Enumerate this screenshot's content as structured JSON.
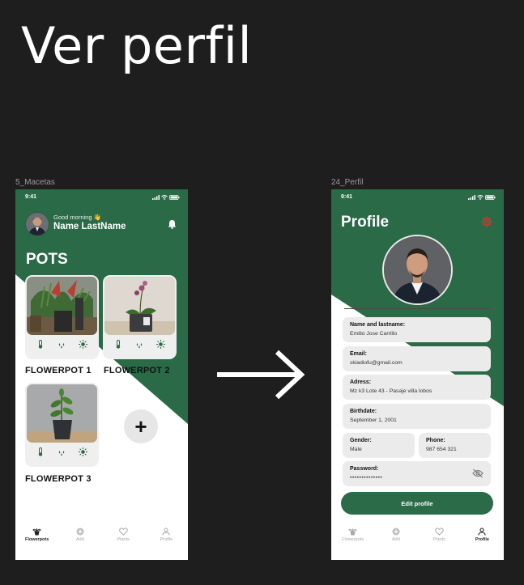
{
  "heading": "Ver perfil",
  "colors": {
    "background": "#1e1e1e",
    "brand_green": "#2a6a47",
    "button_green": "#2c6b48",
    "card_gray": "#efefef",
    "field_gray": "#ebebeb",
    "gear_red": "#c83b2c"
  },
  "frame_left": {
    "label": "5_Macetas",
    "status_time": "9:41",
    "greeting": "Good morning 👋",
    "user_name": "Name LastName",
    "section_title": "POTS",
    "pots": [
      {
        "label": "FLOWERPOT 1",
        "icons": [
          "thermometer-icon",
          "water-drops-icon",
          "sun-icon"
        ]
      },
      {
        "label": "FLOWERPOT 2",
        "icons": [
          "thermometer-icon",
          "water-drops-icon",
          "sun-icon"
        ]
      },
      {
        "label": "FLOWERPOT 3",
        "icons": [
          "thermometer-icon",
          "water-drops-icon",
          "sun-icon"
        ]
      }
    ],
    "add_symbol": "+",
    "tabs": [
      {
        "label": "Flowerpots",
        "icon": "flowerpot-icon",
        "active": true
      },
      {
        "label": "Add",
        "icon": "add-icon",
        "active": false
      },
      {
        "label": "Plants",
        "icon": "heart-icon",
        "active": false
      },
      {
        "label": "Profile",
        "icon": "person-icon",
        "active": false
      }
    ]
  },
  "arrow": "arrow-right-icon",
  "frame_right": {
    "label": "24_Perfil",
    "status_time": "9:41",
    "title": "Profile",
    "fields": {
      "name": {
        "label": "Name and lastname:",
        "value": "Emilio Jose Carrillo"
      },
      "email": {
        "label": "Email:",
        "value": "skiadiofu@gmail.com"
      },
      "address": {
        "label": "Adress:",
        "value": "Mz k3 Lote 43 - Pasaje villa lobos"
      },
      "birthdate": {
        "label": "Birthdate:",
        "value": "September 1, 2001"
      },
      "gender": {
        "label": "Gender:",
        "value": "Male"
      },
      "phone": {
        "label": "Phone:",
        "value": "987 654 321"
      },
      "password": {
        "label": "Password:",
        "value": "••••••••••••••"
      }
    },
    "edit_button": "Edit profile",
    "tabs": [
      {
        "label": "Flowerpots",
        "icon": "flowerpot-icon",
        "active": false
      },
      {
        "label": "Add",
        "icon": "add-icon",
        "active": false
      },
      {
        "label": "Plants",
        "icon": "heart-icon",
        "active": false
      },
      {
        "label": "Profile",
        "icon": "person-icon",
        "active": true
      }
    ]
  }
}
